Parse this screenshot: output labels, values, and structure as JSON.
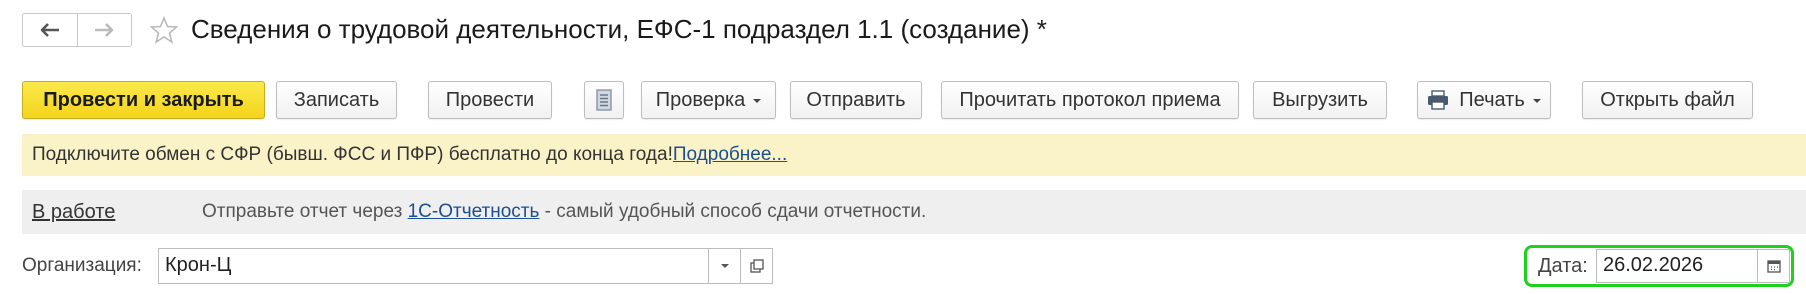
{
  "header": {
    "title": "Сведения о трудовой деятельности, ЕФС-1 подраздел 1.1 (создание) *"
  },
  "toolbar": {
    "post_and_close": "Провести и закрыть",
    "save": "Записать",
    "post": "Провести",
    "check": "Проверка",
    "send": "Отправить",
    "read_protocol": "Прочитать протокол приема",
    "export": "Выгрузить",
    "print": "Печать",
    "open_file": "Открыть файл"
  },
  "banner": {
    "text": "Подключите обмен с СФР (бывш. ФСС и ПФР) бесплатно до конца года! ",
    "link": "Подробнее..."
  },
  "status": {
    "label": "В работе",
    "text_before": "Отправьте отчет через ",
    "link": "1С-Отчетность",
    "text_after": " - самый удобный способ сдачи отчетности."
  },
  "form": {
    "organization_label": "Организация:",
    "organization_value": "Крон-Ц",
    "date_label": "Дата:",
    "date_value": "26.02.2026"
  },
  "icons": {
    "back": "arrow-left-icon",
    "forward": "arrow-right-icon",
    "favorite": "star-icon",
    "report": "document-list-icon",
    "print": "printer-icon",
    "dropdown": "caret-down-icon",
    "open": "open-window-icon",
    "calendar": "calendar-icon"
  },
  "colors": {
    "primary_button": "#f4d41c",
    "banner_background": "#fbf3c8",
    "link": "#1b4f91",
    "highlight": "#1fd11f"
  }
}
